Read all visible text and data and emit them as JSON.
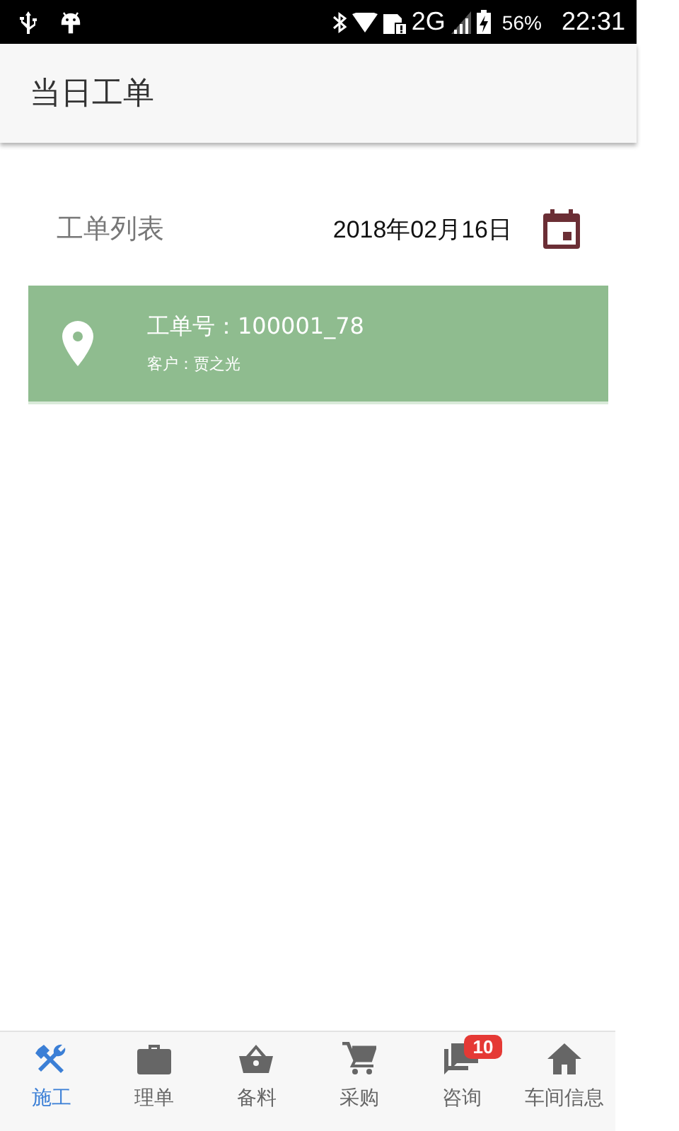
{
  "status_bar": {
    "network": "2G",
    "battery": "56%",
    "time": "22:31"
  },
  "app_bar": {
    "title": "当日工单"
  },
  "list_header": {
    "title": "工单列表",
    "date": "2018年02月16日"
  },
  "orders": [
    {
      "number": "工单号：100001_78",
      "customer": "客户：贾之光",
      "color": "#8fbc8f"
    }
  ],
  "bottom_nav": [
    {
      "kind": "tools",
      "label": "施工",
      "selected": true
    },
    {
      "kind": "briefcase",
      "label": "理单",
      "selected": false
    },
    {
      "kind": "basket",
      "label": "备料",
      "selected": false
    },
    {
      "kind": "cart",
      "label": "采购",
      "selected": false
    },
    {
      "kind": "chat",
      "label": "咨询",
      "selected": false,
      "badge": "10"
    },
    {
      "kind": "home",
      "label": "车间信息",
      "selected": false
    }
  ]
}
